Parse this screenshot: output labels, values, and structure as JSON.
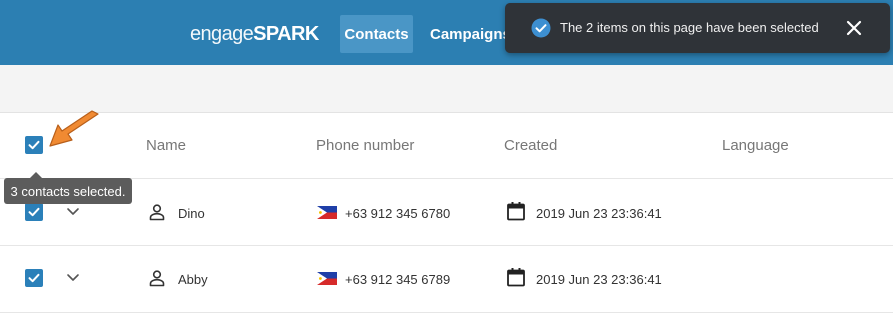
{
  "header": {
    "logo_light": "engage",
    "logo_bold": "SPARK",
    "nav": [
      {
        "label": "Contacts"
      },
      {
        "label": "Campaigns"
      }
    ]
  },
  "toast": {
    "message": "The 2 items on this page have been selected",
    "icon": "check-circle-icon",
    "close_icon": "close-icon"
  },
  "table": {
    "columns": [
      "Name",
      "Phone number",
      "Created",
      "Language"
    ],
    "tooltip": "3 contacts selected.",
    "rows": [
      {
        "name": "Dino",
        "phone": "+63 912 345 6780",
        "created": "2019 Jun 23 23:36:41",
        "flag": "philippines-flag"
      },
      {
        "name": "Abby",
        "phone": "+63 912 345 6789",
        "created": "2019 Jun 23 23:36:41",
        "flag": "philippines-flag"
      }
    ]
  },
  "colors": {
    "topbar": "#2c7fb2",
    "nav_active": "#4a96c6",
    "checkbox": "#2b80b9",
    "toast_bg": "#2f3338",
    "annotation_arrow": "#f08a32"
  }
}
